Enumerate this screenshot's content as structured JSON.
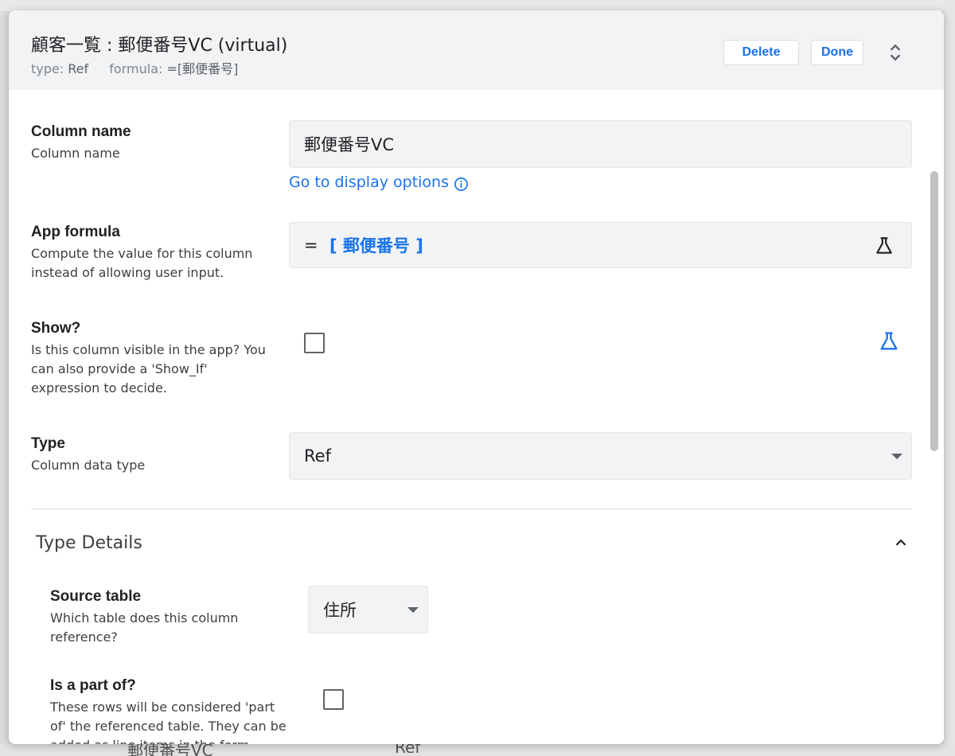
{
  "header": {
    "title": "顧客一覧 : 郵便番号VC (virtual)",
    "type_label": "type:",
    "type_value": "Ref",
    "formula_label": "formula:",
    "formula_value": "=[郵便番号]",
    "delete_label": "Delete",
    "done_label": "Done"
  },
  "column_name": {
    "label": "Column name",
    "description": "Column name",
    "value": "郵便番号VC",
    "link": "Go to display options"
  },
  "app_formula": {
    "label": "App formula",
    "description": "Compute the value for this column instead of allowing user input.",
    "equals": "=",
    "expression": "[ 郵便番号 ]"
  },
  "show": {
    "label": "Show?",
    "description": "Is this column visible in the app? You can also provide a 'Show_If' expression to decide.",
    "checked": false
  },
  "type": {
    "label": "Type",
    "description": "Column data type",
    "value": "Ref"
  },
  "type_details": {
    "title": "Type Details",
    "source_table": {
      "label": "Source table",
      "description": "Which table does this column reference?",
      "value": "住所"
    },
    "is_part_of": {
      "label": "Is a part of?",
      "description": "These rows will be considered 'part of' the referenced table. They can be added as line items in the form",
      "checked": false
    }
  },
  "background": {
    "row_name": "郵便番号VC",
    "row_type": "Ref"
  },
  "colors": {
    "accent": "#1a73e8",
    "header_bg": "#f1f3f4",
    "field_bg": "#f1f3f4"
  }
}
